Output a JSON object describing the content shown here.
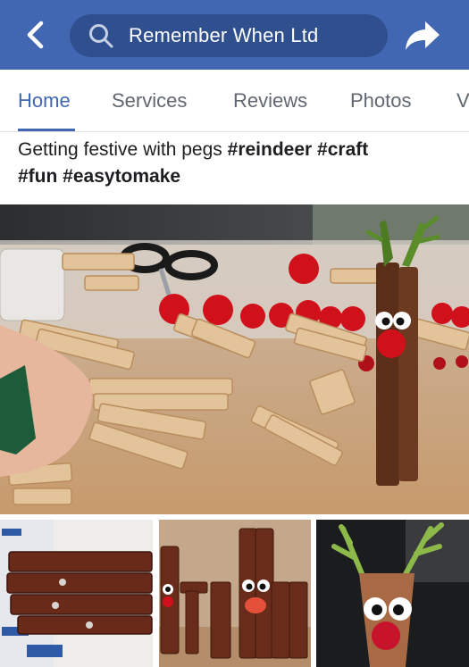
{
  "header": {
    "back_icon": "chevron-left-icon",
    "search_icon": "search-icon",
    "page_name": "Remember When Ltd",
    "share_icon": "share-arrow-icon",
    "bar_color": "#4267b2",
    "search_bg": "#2f4f8f"
  },
  "tabs": [
    {
      "label": "Home",
      "active": true
    },
    {
      "label": "Services",
      "active": false
    },
    {
      "label": "Reviews",
      "active": false
    },
    {
      "label": "Photos",
      "active": false
    },
    {
      "label": "V",
      "active": false
    }
  ],
  "post": {
    "text": "Getting festive with pegs",
    "hashtags": [
      "#reindeer",
      "#craft",
      "#fun",
      "#easytomake"
    ]
  },
  "photos": {
    "main": "craft-table-reindeer-peg-photo",
    "thumbnails": [
      "painted-pegs-closeup-photo",
      "three-peg-reindeer-photo",
      "reindeer-face-closeup-photo"
    ]
  }
}
